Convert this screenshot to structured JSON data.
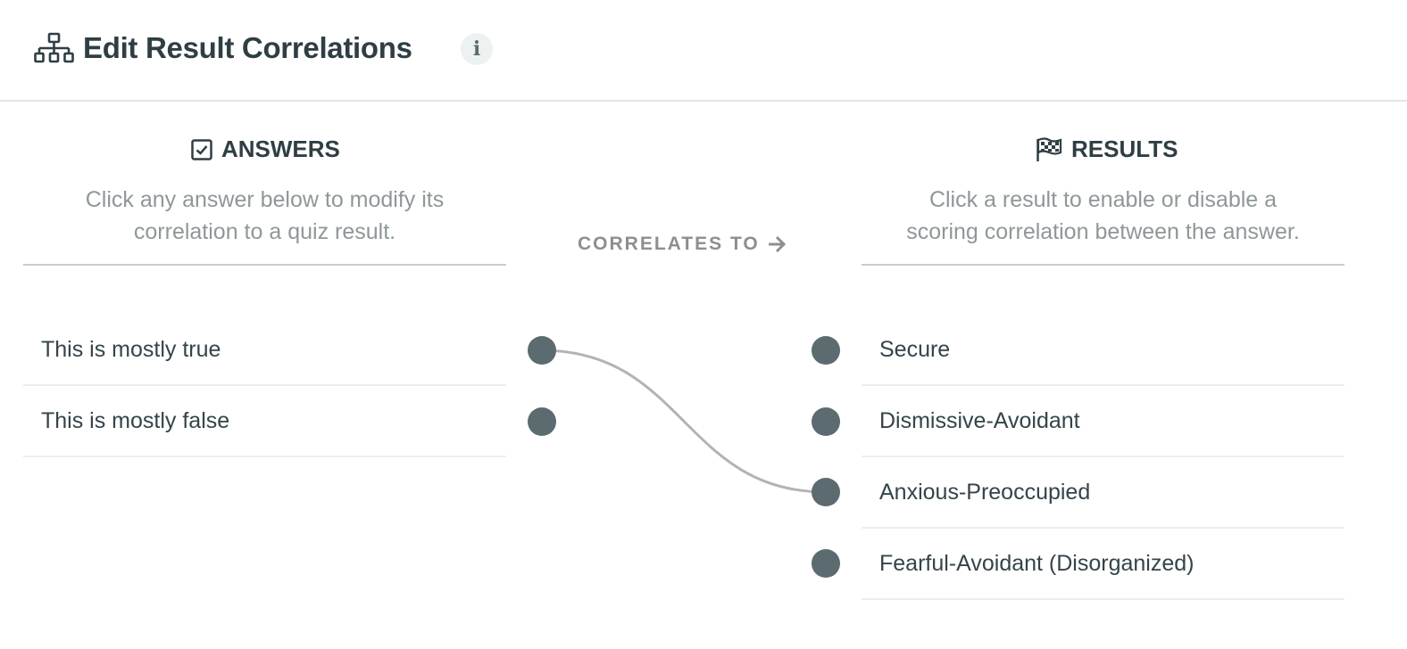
{
  "header": {
    "icon": "sitemap-icon",
    "title": "Edit Result Correlations",
    "info_icon": "info-icon",
    "info_glyph": "i"
  },
  "answers": {
    "icon": "checkbox-checked-icon",
    "heading": "ANSWERS",
    "description_line1": "Click any answer below to modify its",
    "description_line2": "correlation to a quiz result.",
    "items": [
      {
        "label": "This is mostly true"
      },
      {
        "label": "This is mostly false"
      }
    ]
  },
  "middle": {
    "label": "CORRELATES TO",
    "arrow_icon": "arrow-right-icon"
  },
  "results": {
    "icon": "checkered-flag-icon",
    "heading": "RESULTS",
    "description_line1": "Click a result to enable or disable a",
    "description_line2": "scoring correlation between the answer.",
    "items": [
      {
        "label": "Secure"
      },
      {
        "label": "Dismissive-Avoidant"
      },
      {
        "label": "Anxious-Preoccupied"
      },
      {
        "label": "Fearful-Avoidant (Disorganized)"
      }
    ]
  },
  "correlations": [
    {
      "answer_index": 0,
      "result_index": 2
    }
  ],
  "colors": {
    "dot": "#5b6b70",
    "link_line": "#b3b3b3",
    "heading": "#2f3e44",
    "muted_text": "#8f9799"
  }
}
